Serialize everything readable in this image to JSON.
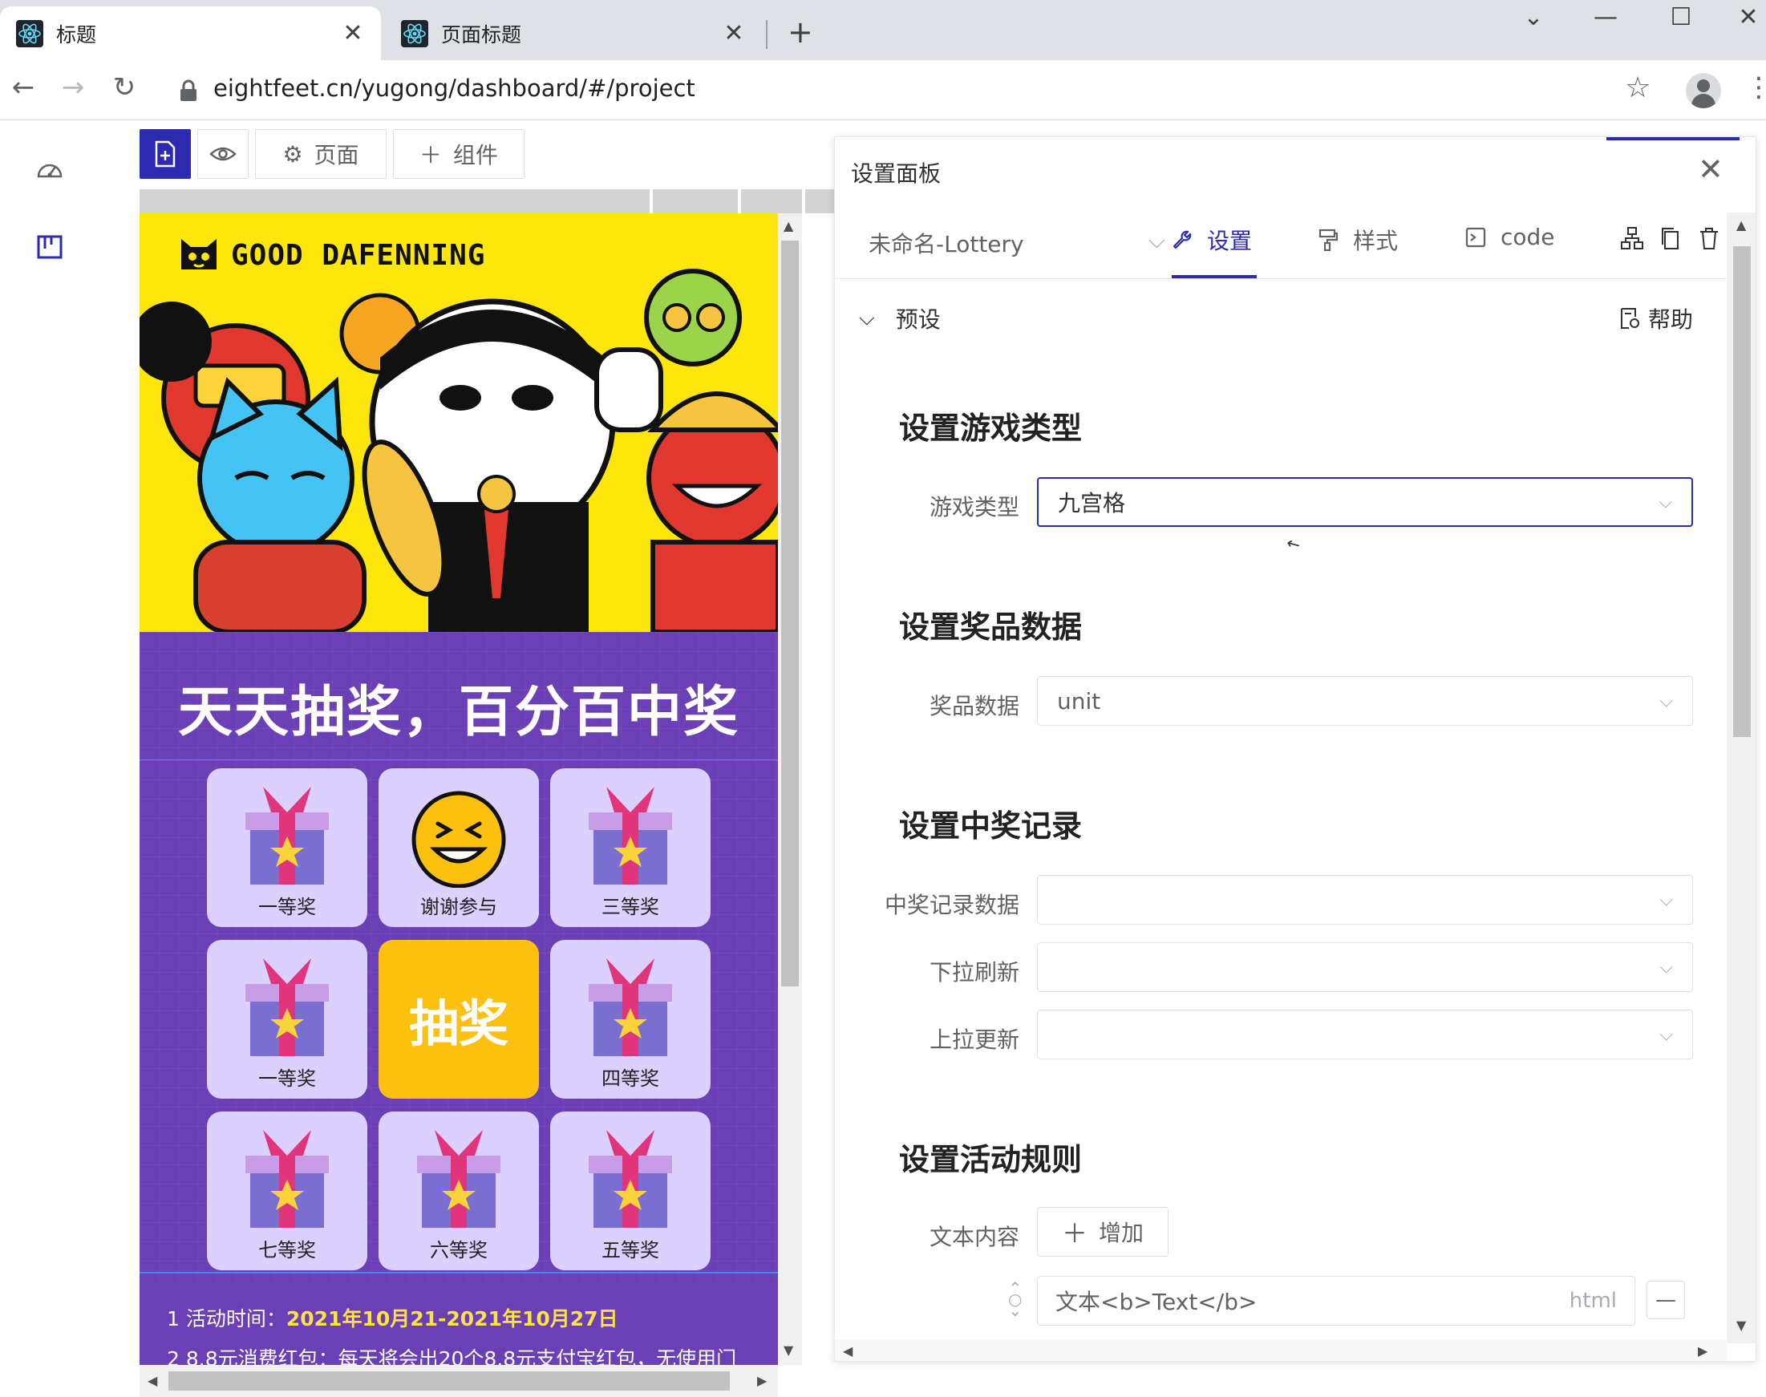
{
  "browser": {
    "tabs": [
      {
        "title": "标题",
        "active": true
      },
      {
        "title": "页面标题",
        "active": false
      }
    ],
    "new_tab": "+",
    "url": "eightfeet.cn/yugong/dashboard/#/project",
    "window_controls": {
      "dropdown": "⌄",
      "minimize": "—",
      "maximize": "☐",
      "close": "✕"
    }
  },
  "toolbar": {
    "page_label": "页面",
    "component_label": "组件"
  },
  "preview": {
    "brand": "GOOD DAFENNING",
    "slogan": "天天抽奖，百分百中奖",
    "prizes": [
      {
        "label": "一等奖",
        "icon": "gift-icon"
      },
      {
        "label": "谢谢参与",
        "icon": "laughing-face-icon"
      },
      {
        "label": "三等奖",
        "icon": "gift-icon"
      },
      {
        "label": "一等奖",
        "icon": "gift-icon"
      },
      {
        "label": "抽奖",
        "icon": "draw-button"
      },
      {
        "label": "四等奖",
        "icon": "gift-icon"
      },
      {
        "label": "七等奖",
        "icon": "gift-icon"
      },
      {
        "label": "六等奖",
        "icon": "gift-icon"
      },
      {
        "label": "五等奖",
        "icon": "gift-icon"
      }
    ],
    "rules": {
      "line1_prefix": "1 活动时间：",
      "line1_value": "2021年10月21-2021年10月27日",
      "line2": "2 8.8元消费红包：每天将会出20个8.8元支付宝红包，无使用门"
    },
    "colors": {
      "banner": "#fde60b",
      "background": "#6b3fb5",
      "cell": "#dcd0ff",
      "draw": "#fcc10f"
    }
  },
  "panel": {
    "title": "设置面板",
    "component_name": "未命名-Lottery",
    "tabs": [
      {
        "label": "设置",
        "icon": "wrench-icon",
        "active": true
      },
      {
        "label": "样式",
        "icon": "paint-roller-icon",
        "active": false
      },
      {
        "label": "code",
        "icon": "terminal-icon",
        "active": false
      }
    ],
    "section": "预设",
    "help": "帮助",
    "groups": {
      "game_type": {
        "title": "设置游戏类型",
        "label": "游戏类型",
        "value": "九宫格"
      },
      "prize_data": {
        "title": "设置奖品数据",
        "label": "奖品数据",
        "value": "unit"
      },
      "records": {
        "title": "设置中奖记录",
        "fields": [
          {
            "label": "中奖记录数据",
            "value": ""
          },
          {
            "label": "下拉刷新",
            "value": ""
          },
          {
            "label": "上拉更新",
            "value": ""
          }
        ]
      },
      "rules": {
        "title": "设置活动规则",
        "label": "文本内容",
        "add_label": "增加",
        "text_value": "文本<b>Text</b>",
        "suffix": "html",
        "remove_label": "—"
      }
    },
    "accent_color": "#2b2ab0"
  }
}
